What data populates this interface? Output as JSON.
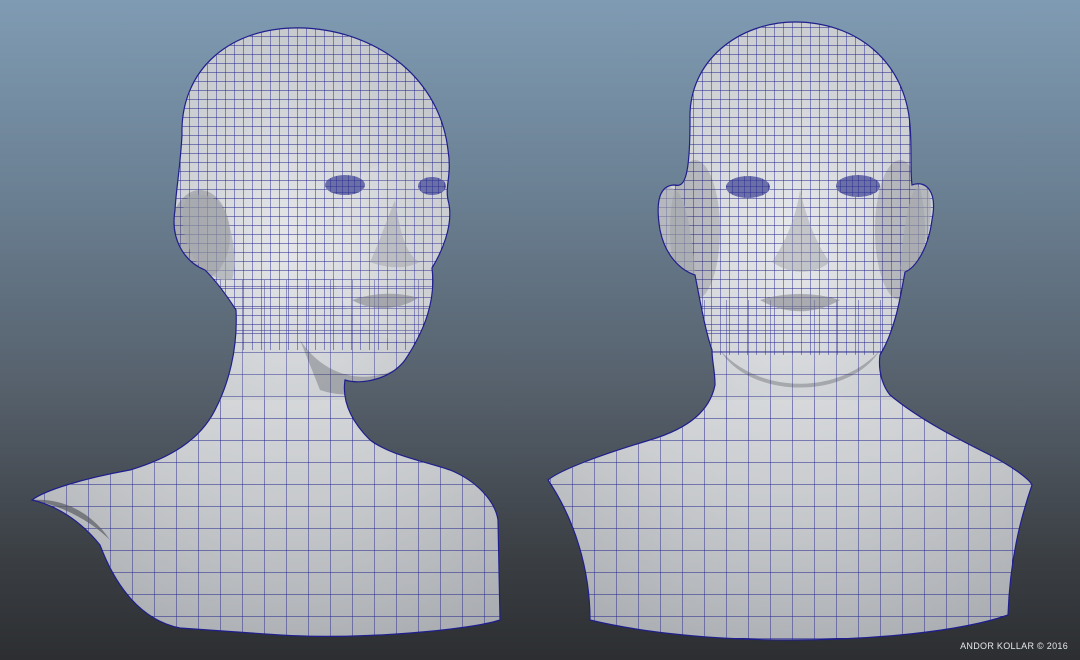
{
  "scene": {
    "models": [
      {
        "name": "head-three-quarter-view",
        "view": "three-quarter"
      },
      {
        "name": "head-front-view",
        "view": "front"
      }
    ],
    "mesh_color": "#1f1f8c",
    "surface_color": "#c8cacd",
    "background_top": "#7f9bb3",
    "background_bottom": "#2c2e31"
  },
  "credit": "ANDOR KOLLAR © 2016"
}
